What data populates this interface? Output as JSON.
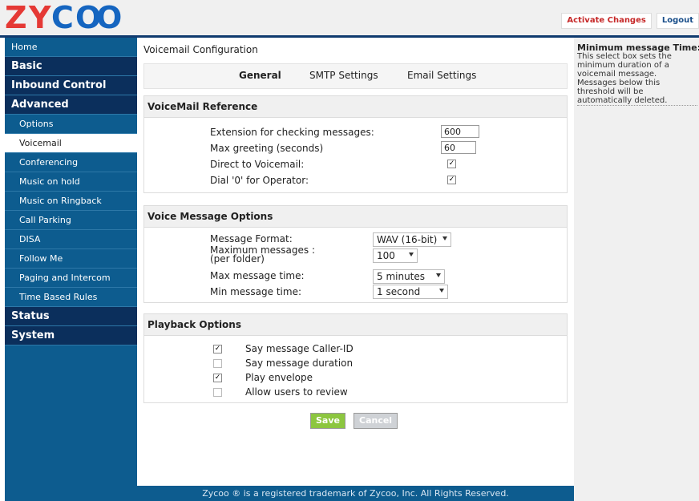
{
  "brand": {
    "logo_text": "ZYCOO",
    "logo_colors": {
      "z": "#e53935",
      "y": "#e53935",
      "c": "#1565c0",
      "o": "#1565c0"
    }
  },
  "top_actions": {
    "activate": "Activate Changes",
    "logout": "Logout"
  },
  "sidebar": {
    "home": "Home",
    "basic": "Basic",
    "inbound": "Inbound Control",
    "advanced": "Advanced",
    "sub_items": [
      "Options",
      "Voicemail",
      "Conferencing",
      "Music on hold",
      "Music on Ringback",
      "Call Parking",
      "DISA",
      "Follow Me",
      "Paging and Intercom",
      "Time Based Rules"
    ],
    "status": "Status",
    "system": "System",
    "active_index": 1
  },
  "main": {
    "title": "Voicemail Configuration",
    "tabs": [
      "General",
      "SMTP Settings",
      "Email Settings"
    ],
    "active_tab": 0
  },
  "reference": {
    "heading": "VoiceMail Reference",
    "ext_label": "Extension for checking messages:",
    "ext_value": "600",
    "greet_label": "Max greeting (seconds)",
    "greet_value": "60",
    "direct_label": "Direct to Voicemail:",
    "direct_checked": true,
    "dial0_label": "Dial '0' for Operator:",
    "dial0_checked": true
  },
  "voice_options": {
    "heading": "Voice Message Options",
    "format_label": "Message Format:",
    "format_value": "WAV (16-bit)",
    "maxmsg_label_1": "Maximum messages :",
    "maxmsg_label_2": "(per folder)",
    "maxmsg_value": "100",
    "maxtime_label": "Max message time:",
    "maxtime_value": "5 minutes",
    "mintime_label": "Min message time:",
    "mintime_value": "1 second"
  },
  "playback": {
    "heading": "Playback Options",
    "items": [
      {
        "label": "Say message Caller-ID",
        "checked": true
      },
      {
        "label": "Say message duration",
        "checked": false
      },
      {
        "label": "Play envelope",
        "checked": true
      },
      {
        "label": "Allow users to review",
        "checked": false
      }
    ]
  },
  "buttons": {
    "save": "Save",
    "cancel": "Cancel"
  },
  "footer": "Zycoo ® is a registered trademark of Zycoo, Inc. All Rights Reserved.",
  "help": {
    "title": "Minimum message Time:",
    "text": "This select box sets the minimum duration of a voicemail message. Messages below this threshold will be automatically deleted."
  }
}
